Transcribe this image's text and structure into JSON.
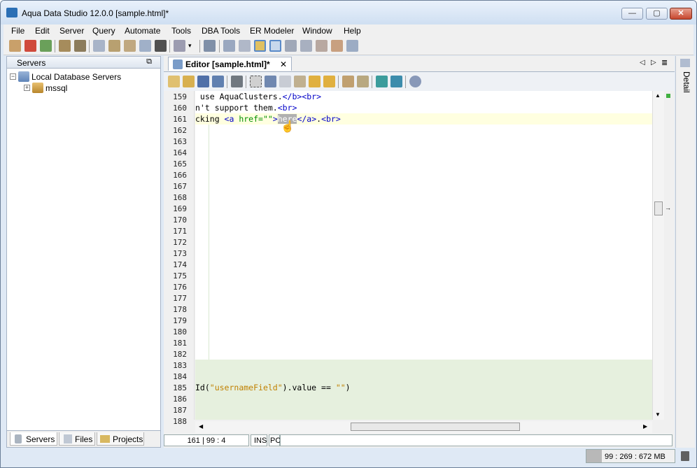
{
  "window": {
    "title": "Aqua Data Studio 12.0.0 [sample.html]*",
    "min_label": "—",
    "max_label": "▢",
    "close_label": "✕"
  },
  "menu": [
    "File",
    "Edit",
    "Server",
    "Query",
    "Automate",
    "Tools",
    "DBA Tools",
    "ER Modeler",
    "Window",
    "Help"
  ],
  "servers_panel": {
    "title": "Servers",
    "restore_glyph": "⧉",
    "tree": {
      "root": "Local Database Servers",
      "child": "mssql"
    },
    "tabs": [
      "Servers",
      "Files",
      "Projects"
    ]
  },
  "editor": {
    "tab_title": "Editor [sample.html]*",
    "tab_close": "✕",
    "line_numbers": [
      "159",
      "160",
      "161",
      "162",
      "163",
      "164",
      "165",
      "166",
      "167",
      "168",
      "169",
      "170",
      "171",
      "172",
      "173",
      "174",
      "175",
      "176",
      "177",
      "178",
      "179",
      "180",
      "181",
      "182",
      "183",
      "184",
      "185",
      "186",
      "187",
      "188"
    ],
    "lines": {
      "l159": [
        {
          "t": " use AquaClusters.",
          "c": ""
        },
        {
          "t": "</b><br>",
          "c": "blue"
        }
      ],
      "l160": [
        {
          "t": "n't support them.",
          "c": ""
        },
        {
          "t": "<br>",
          "c": "blue"
        }
      ],
      "l161": [
        {
          "t": "cking ",
          "c": ""
        },
        {
          "t": "<a ",
          "c": "blue"
        },
        {
          "t": "href=\"\"",
          "c": "green"
        },
        {
          "t": ">",
          "c": "blue"
        },
        {
          "t": "here",
          "c": "sel"
        },
        {
          "t": "</a>",
          "c": "blue"
        },
        {
          "t": ".",
          "c": ""
        },
        {
          "t": "<br>",
          "c": "blue"
        }
      ],
      "l185": [
        {
          "t": "Id(",
          "c": ""
        },
        {
          "t": "\"usernameField\"",
          "c": "orange"
        },
        {
          "t": ").value == ",
          "c": ""
        },
        {
          "t": "\"\"",
          "c": "orange"
        },
        {
          "t": ")",
          "c": ""
        }
      ]
    },
    "status": {
      "position": "161 | 99 : 4",
      "mode": "INS",
      "encoding": "PC"
    },
    "nav": {
      "prev": "◁",
      "next": "▷",
      "list": "≣"
    }
  },
  "right_strip": {
    "label": "Detail"
  },
  "memory": "99 : 269 : 672 MB",
  "colors": {
    "accent": "#2b6fb5",
    "current_line": "#ffffe0",
    "highlight_block": "#e6f0de",
    "selection": "#b0b0b0"
  }
}
